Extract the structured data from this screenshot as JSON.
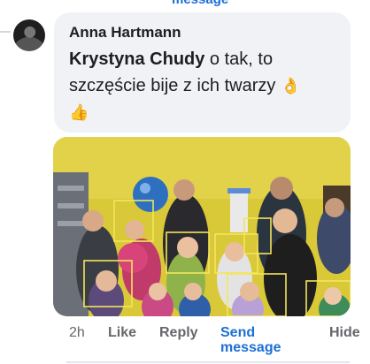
{
  "top_cut_link": "message",
  "comment": {
    "author": "Anna Hartmann",
    "mention": "Krystyna Chudy",
    "text": " o tak, to szczęście bije z ich twarzy ",
    "emoji_1": "👌",
    "emoji_2": "👍"
  },
  "actions": {
    "time": "2h",
    "like": "Like",
    "reply": "Reply",
    "send_message": "Send message",
    "hide": "Hide"
  },
  "colors": {
    "link_blue": "#1b6fd6",
    "bubble_bg": "#f0f2f5",
    "muted_text": "#65676b"
  }
}
